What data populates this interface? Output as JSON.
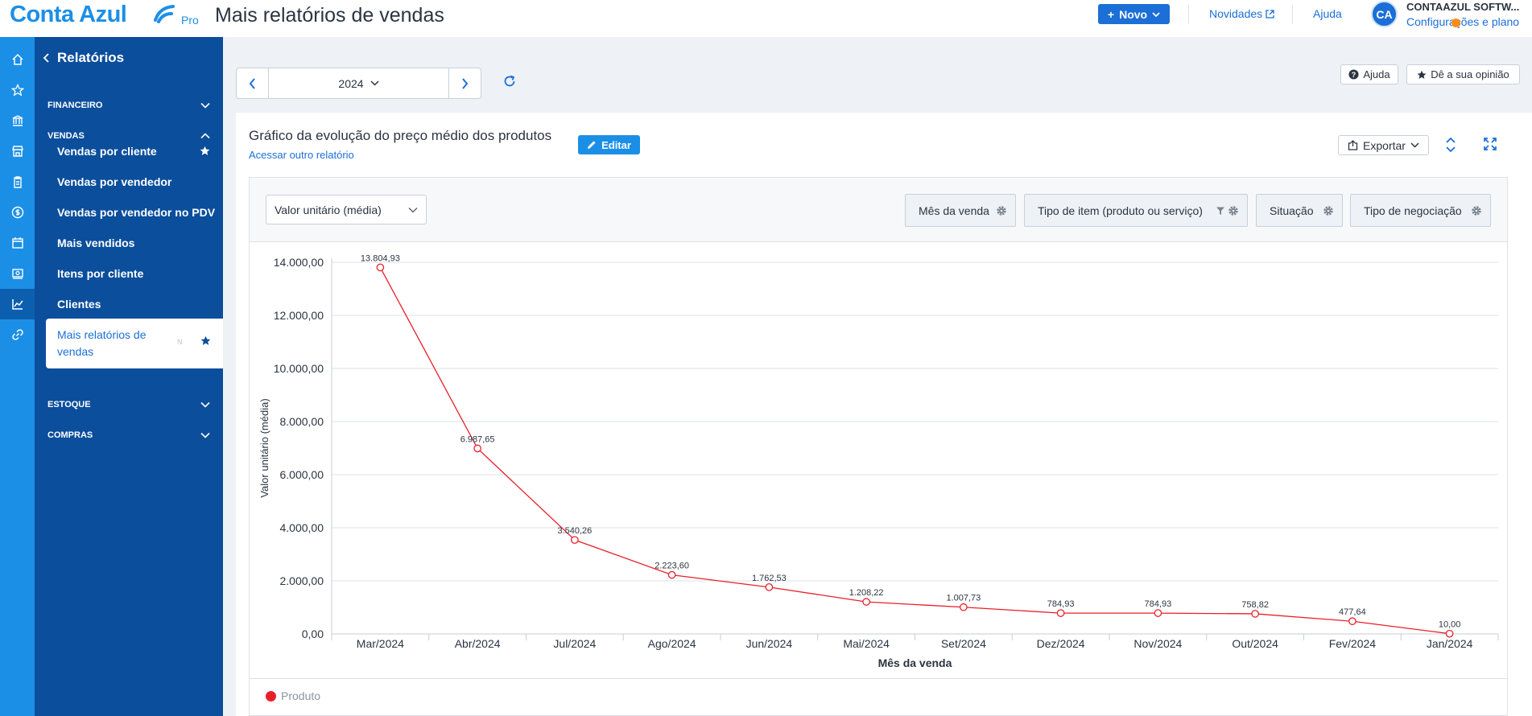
{
  "topbar": {
    "logo": "Conta Azul",
    "logo_pro": "Pro",
    "page_title": "Mais relatórios de vendas",
    "novo_label": "Novo",
    "novidades_label": "Novidades",
    "ajuda_label": "Ajuda",
    "avatar_initials": "CA",
    "company_name": "CONTAAZUL SOFTW...",
    "config_label": "Configurações e plano"
  },
  "rail": {
    "icons": [
      "home-icon",
      "star-icon",
      "bank-icon",
      "store-icon",
      "clipboard-icon",
      "dollar-icon",
      "calendar-dollar-icon",
      "cash-icon",
      "chart-line-icon",
      "link-icon"
    ],
    "active_index": 8
  },
  "submenu": {
    "header": "Relatórios",
    "sections": {
      "financeiro": "FINANCEIRO",
      "vendas": "VENDAS",
      "estoque": "ESTOQUE",
      "compras": "COMPRAS"
    },
    "vendas_items": [
      {
        "label": "Vendas por cliente",
        "starred": true
      },
      {
        "label": "Vendas por vendedor",
        "starred": false
      },
      {
        "label": "Vendas por vendedor no PDV",
        "starred": false
      },
      {
        "label": "Mais vendidos",
        "starred": false
      },
      {
        "label": "Itens por cliente",
        "starred": false
      },
      {
        "label": "Clientes",
        "starred": false
      }
    ],
    "active_item": {
      "label": "Mais relatórios de vendas",
      "tag": "N"
    }
  },
  "toolbar": {
    "year": "2024",
    "ajuda_label": "Ajuda",
    "opiniao_label": "Dê a sua opinião"
  },
  "report": {
    "title": "Gráfico da evolução do preço médio dos produtos",
    "outro_link": "Acessar outro relatório",
    "editar_label": "Editar",
    "exportar_label": "Exportar",
    "metric": "Valor unitário (média)",
    "filters": [
      "Mês da venda",
      "Tipo de item (produto ou serviço)",
      "Situação",
      "Tipo de negociação"
    ],
    "legend": "Produto"
  },
  "chart_data": {
    "type": "line",
    "categories": [
      "Mar/2024",
      "Abr/2024",
      "Jul/2024",
      "Ago/2024",
      "Jun/2024",
      "Mai/2024",
      "Set/2024",
      "Dez/2024",
      "Nov/2024",
      "Out/2024",
      "Fev/2024",
      "Jan/2024"
    ],
    "series": [
      {
        "name": "Produto",
        "values": [
          13804.93,
          6987.65,
          3540.26,
          2223.6,
          1762.53,
          1208.22,
          1007.73,
          784.93,
          784.93,
          758.82,
          477.64,
          10.0
        ],
        "labels": [
          "13.804,93",
          "6.987,65",
          "3.540,26",
          "2.223,60",
          "1.762,53",
          "1.208,22",
          "1.007,73",
          "784,93",
          "784,93",
          "758,82",
          "477,64",
          "10,00"
        ],
        "color": "#e8202a"
      }
    ],
    "yticks": [
      "0,00",
      "2.000,00",
      "4.000,00",
      "6.000,00",
      "8.000,00",
      "10.000,00",
      "12.000,00",
      "14.000,00"
    ],
    "ylim": [
      0,
      14000
    ],
    "xlabel": "Mês da venda",
    "ylabel": "Valor unitário (média)",
    "grid": true,
    "legend_position": "bottom-left"
  },
  "colors": {
    "brand": "#1b8fe6",
    "brand_dark": "#0b4e9c",
    "series": "#e8202a"
  }
}
